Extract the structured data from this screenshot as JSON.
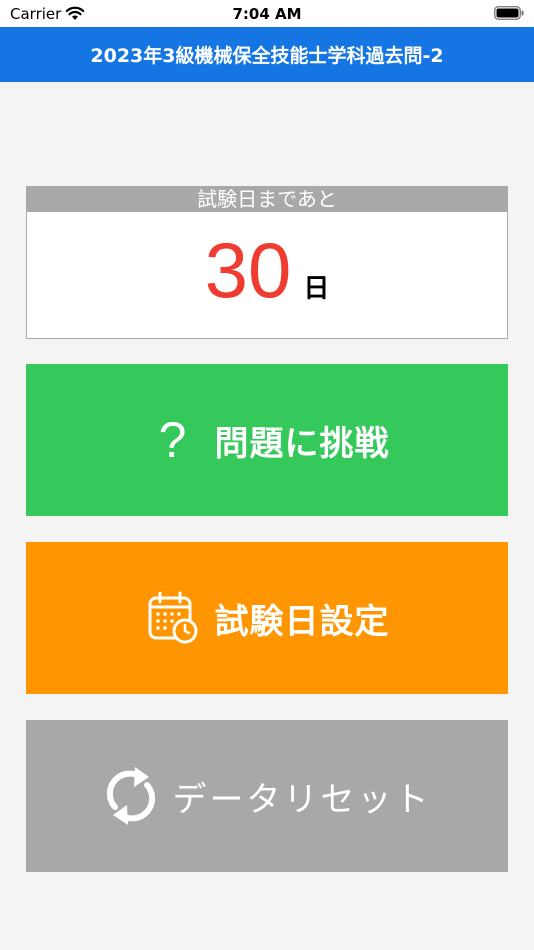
{
  "status_bar": {
    "carrier": "Carrier",
    "time": "7:04 AM",
    "wifi_icon": "wifi-icon",
    "battery_icon": "battery-icon"
  },
  "nav": {
    "title": "2023年3級機械保全技能士学科過去問-2"
  },
  "countdown": {
    "label": "試験日まであと",
    "days": "30",
    "unit": "日"
  },
  "buttons": {
    "challenge": {
      "label": "問題に挑戦",
      "icon": "question-mark-icon",
      "color": "#35c85a"
    },
    "exam_date": {
      "label": "試験日設定",
      "icon": "calendar-clock-icon",
      "color": "#ff9500"
    },
    "reset": {
      "label": "データリセット",
      "icon": "refresh-icon",
      "color": "#a8a8a8"
    }
  },
  "colors": {
    "nav_bg": "#1576e3",
    "countdown_number": "#f03c30",
    "background": "#f4f4f4"
  }
}
